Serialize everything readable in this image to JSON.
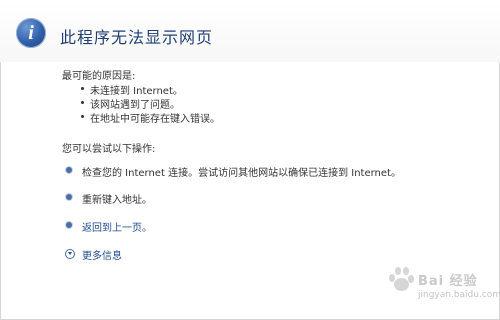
{
  "page": {
    "title": "此程序无法显示网页",
    "reasons_heading": "最可能的原因是:",
    "reasons": [
      "未连接到 Internet。",
      "该网站遇到了问题。",
      "在地址中可能存在键入错误。"
    ],
    "actions_heading": "您可以尝试以下操作:",
    "actions": [
      "检查您的 Internet 连接。尝试访问其他网站以确保已连接到 Internet。",
      "重新键入地址。",
      "返回到上一页。"
    ],
    "more_info": "更多信息"
  },
  "watermark": {
    "text": "Bai 经验",
    "sub": "jingyan.baidu.com"
  },
  "colors": {
    "title": "#1f3f75",
    "link": "#1f4b8f",
    "icon_blue": "#2f5fa8"
  },
  "icons": [
    "info-icon",
    "bullet-icon",
    "expand-icon",
    "baidu-paw-icon"
  ]
}
